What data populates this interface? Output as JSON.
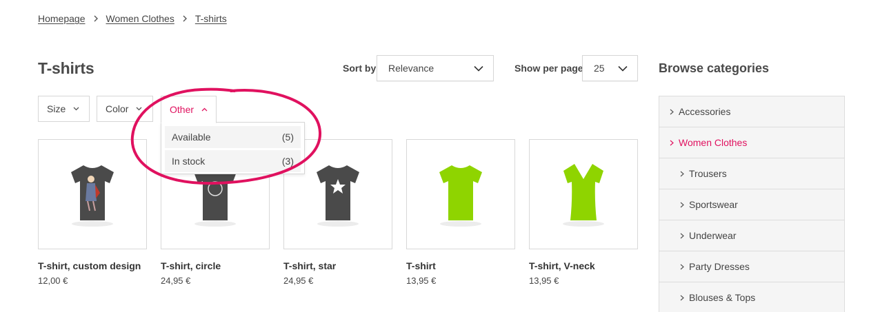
{
  "colors": {
    "accent": "#e0115f",
    "tshirt_dark": "#4a4a4a",
    "tshirt_green": "#8fd400",
    "border": "#d6d6d6"
  },
  "breadcrumb": [
    {
      "label": "Homepage"
    },
    {
      "label": "Women Clothes"
    },
    {
      "label": "T-shirts"
    }
  ],
  "page_title": "T-shirts",
  "sort": {
    "label": "Sort by",
    "value": "Relevance"
  },
  "per_page": {
    "label": "Show per page",
    "value": "25"
  },
  "filters": [
    {
      "label": "Size",
      "expanded": false
    },
    {
      "label": "Color",
      "expanded": false
    },
    {
      "label": "Other",
      "expanded": true
    }
  ],
  "other_dropdown": [
    {
      "label": "Available",
      "count": "(5)"
    },
    {
      "label": "In stock",
      "count": "(3)"
    }
  ],
  "products": [
    {
      "name": "T-shirt, custom design",
      "price": "12,00 €",
      "image": "dark-tshirt-custom-print"
    },
    {
      "name": "T-shirt, circle",
      "price": "24,95 €",
      "image": "dark-tshirt-circle"
    },
    {
      "name": "T-shirt, star",
      "price": "24,95 €",
      "image": "dark-tshirt-star"
    },
    {
      "name": "T-shirt",
      "price": "13,95 €",
      "image": "green-tshirt"
    },
    {
      "name": "T-shirt, V-neck",
      "price": "13,95 €",
      "image": "green-tshirt-vneck"
    }
  ],
  "sidebar": {
    "title": "Browse categories",
    "items": [
      {
        "label": "Accessories",
        "level": 0,
        "current": false
      },
      {
        "label": "Women Clothes",
        "level": 0,
        "current": true
      },
      {
        "label": "Trousers",
        "level": 1,
        "current": false
      },
      {
        "label": "Sportswear",
        "level": 1,
        "current": false
      },
      {
        "label": "Underwear",
        "level": 1,
        "current": false
      },
      {
        "label": "Party Dresses",
        "level": 1,
        "current": false
      },
      {
        "label": "Blouses & Tops",
        "level": 1,
        "current": false
      }
    ]
  }
}
